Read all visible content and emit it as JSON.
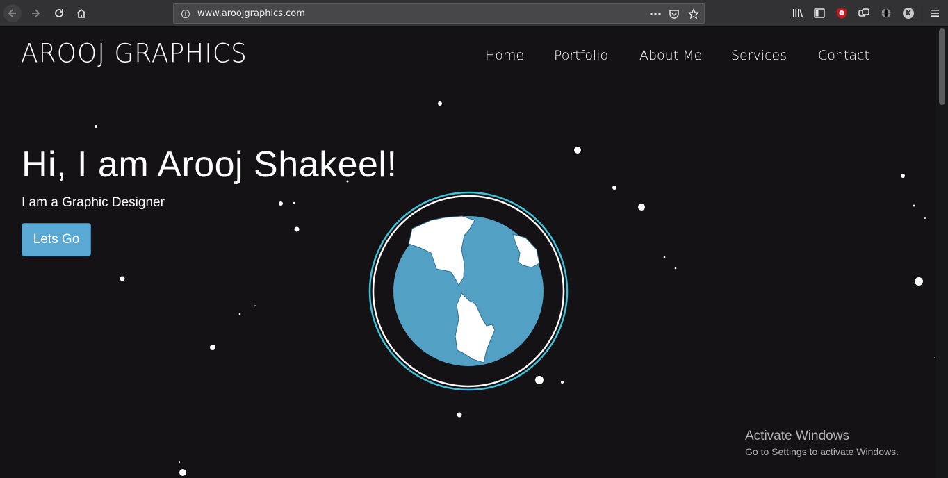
{
  "browser": {
    "url": "www.aroojgraphics.com",
    "icons": [
      "back-icon",
      "forward-icon",
      "reload-icon",
      "home-icon",
      "info-icon",
      "more-icon",
      "pocket-icon",
      "bookmark-star-icon",
      "library-icon",
      "sidebar-icon",
      "ublock-icon",
      "sync-icon",
      "globe-icon",
      "account-icon",
      "menu-icon"
    ],
    "account_initial": "K"
  },
  "site": {
    "brand": "AROOJ GRAPHICS",
    "nav": [
      "Home",
      "Portfolio",
      "About Me",
      "Services",
      "Contact"
    ],
    "hero": {
      "title": "Hi, I am Arooj Shakeel!",
      "subtitle": "I am a Graphic Designer",
      "cta": "Lets Go"
    },
    "colors": {
      "background": "#141214",
      "accent": "#5aa8d4",
      "ring": "#3cc3dc"
    }
  },
  "os_watermark": {
    "line1": "Activate Windows",
    "line2": "Go to Settings to activate Windows."
  }
}
